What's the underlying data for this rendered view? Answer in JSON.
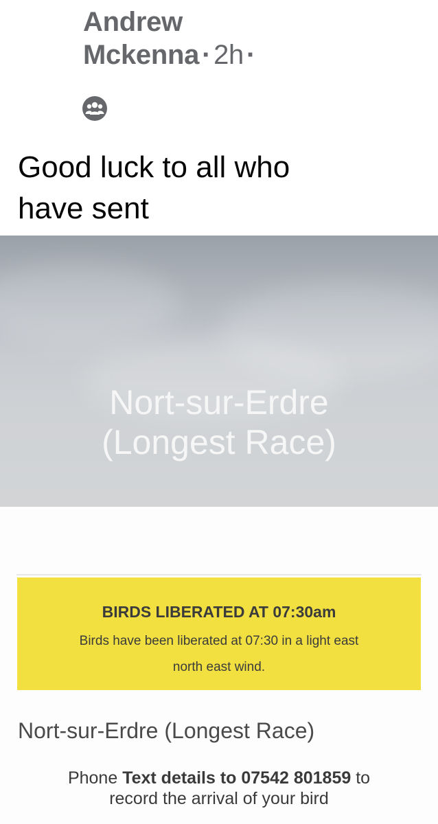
{
  "post": {
    "author_first": "Andrew",
    "author_last": "Mckenna",
    "time_ago": "2h",
    "separator": "·",
    "audience_icon": "group-icon",
    "text_line1": "Good luck to all who",
    "text_line2": "have sent"
  },
  "image": {
    "title_line1": "Nort-sur-Erdre",
    "title_line2": "(Longest Race)"
  },
  "notice": {
    "heading": "BIRDS LIBERATED AT 07:30am",
    "body_line1": "Birds have been liberated at 07:30 in a light east",
    "body_line2": "north east wind."
  },
  "race": {
    "title": "Nort-sur-Erdre (Longest Race)"
  },
  "instructions": {
    "prefix": "Phone ",
    "bold": "Text details to 07542 801859",
    "suffix": " to",
    "line2": "record the arrival of your bird"
  },
  "colors": {
    "meta_text": "#65676b",
    "notice_background": "#f1e040",
    "post_text": "#050505"
  }
}
